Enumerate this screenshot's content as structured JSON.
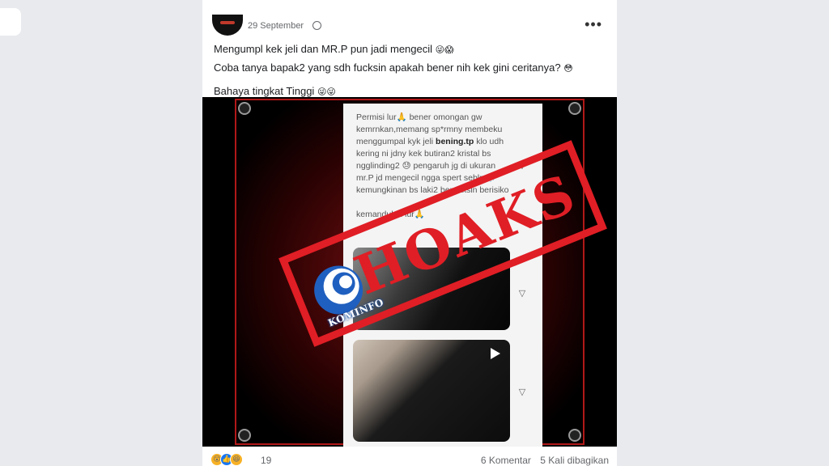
{
  "post": {
    "date": "29 September",
    "menu_icon": "more-horizontal-icon",
    "line1": "Mengumpl kek jeli dan MR.P pun jadi mengecil",
    "line1_emoji": "😜😱",
    "line2": "Coba tanya bapak2 yang sdh fucksin apakah bener nih kek gini ceritanya?",
    "line2_emoji": "😳",
    "line3": "Bahaya tingkat Tinggi",
    "line3_emoji": "😜😜"
  },
  "screenshot": {
    "p1": "Permisi lur🙏 bener omongan gw kemrnkan,memang sp*rmny membeku menggumpal kyk jeli ",
    "bold": "bening.tp",
    "p2": " klo udh kering ni jdny kek butiran2 kristal bs ngglinding2 😓 pengaruh jg di ukuran mr.P jd mengecil ngga spert seblm 💉 kemungkinan bs laki2 berpaksin berisiko",
    "p3": "kemandulan lur🙏"
  },
  "stamp": {
    "text": "HOAKS",
    "logo_label": "KOMINFO",
    "color": "#e01e25"
  },
  "footer": {
    "reaction_count": "19",
    "comments": "6 Komentar",
    "shares": "5 Kali dibagikan"
  }
}
